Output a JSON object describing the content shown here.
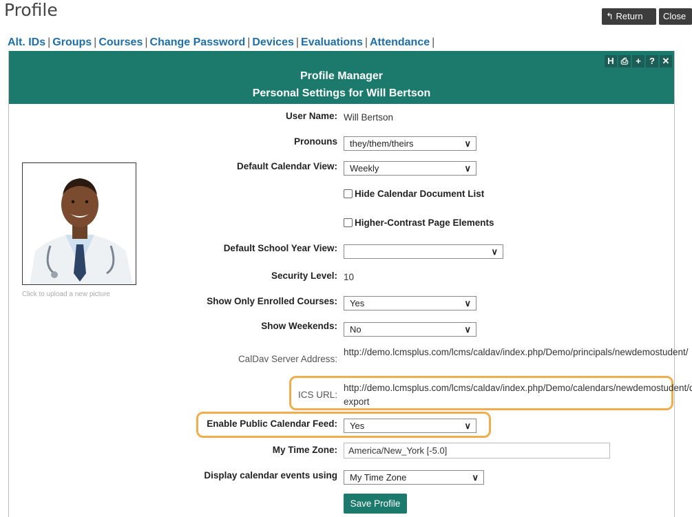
{
  "page": {
    "title": "Profile"
  },
  "top_buttons": {
    "return_label": "Return",
    "close_label": "Close"
  },
  "tabs": [
    {
      "label": "Alt. IDs"
    },
    {
      "label": "Groups"
    },
    {
      "label": "Courses"
    },
    {
      "label": "Change Password"
    },
    {
      "label": "Devices"
    },
    {
      "label": "Evaluations"
    },
    {
      "label": "Attendance"
    }
  ],
  "panel": {
    "title": "Profile Manager",
    "subtitle": "Personal Settings for Will Bertson",
    "icons": [
      {
        "name": "help-h-icon",
        "glyph": "H"
      },
      {
        "name": "print-icon",
        "glyph": "⎙"
      },
      {
        "name": "plus-icon",
        "glyph": "+"
      },
      {
        "name": "question-icon",
        "glyph": "?"
      },
      {
        "name": "close-x-icon",
        "glyph": "✕"
      }
    ]
  },
  "avatar": {
    "upload_note": "Click to upload a new picture"
  },
  "form": {
    "user_name": {
      "label": "User Name:",
      "value": "Will Bertson"
    },
    "pronouns": {
      "label": "Pronouns",
      "value": "they/them/theirs"
    },
    "default_calendar_view": {
      "label": "Default Calendar View:",
      "value": "Weekly"
    },
    "hide_calendar_doc_list": {
      "label": "Hide Calendar Document List",
      "checked": false
    },
    "higher_contrast": {
      "label": "Higher-Contrast Page Elements",
      "checked": false
    },
    "default_school_year_view": {
      "label": "Default School Year View:",
      "value": ""
    },
    "security_level": {
      "label": "Security Level:",
      "value": "10"
    },
    "show_only_enrolled": {
      "label": "Show Only Enrolled Courses:",
      "value": "Yes"
    },
    "show_weekends": {
      "label": "Show Weekends:",
      "value": "No"
    },
    "caldav": {
      "label": "CalDav Server Address:",
      "value": "http://demo.lcmsplus.com/lcms/caldav/index.php/Demo/principals/newdemostudent/"
    },
    "ics_url": {
      "label": "ICS URL:",
      "value": "http://demo.lcmsplus.com/lcms/caldav/index.php/Demo/calendars/newdemostudent/default?export"
    },
    "enable_public_feed": {
      "label": "Enable Public Calendar Feed:",
      "value": "Yes"
    },
    "time_zone": {
      "label": "My Time Zone:",
      "value": "America/New_York [-5.0]"
    },
    "display_events": {
      "label": "Display calendar events using",
      "value": "My Time Zone"
    },
    "save_label": "Save Profile"
  },
  "colors": {
    "accent": "#1c7a6d",
    "link": "#1f6fa6",
    "highlight": "#f0ad4e",
    "dark_button": "#3d3d3d"
  }
}
